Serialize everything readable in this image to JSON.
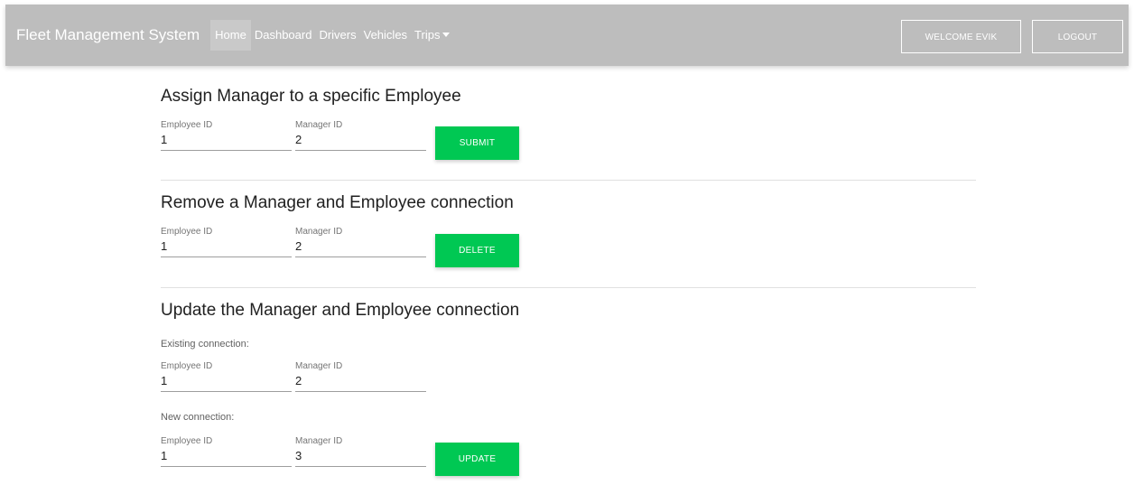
{
  "navbar": {
    "brand": "Fleet Management System",
    "links": [
      {
        "label": "Home",
        "active": true
      },
      {
        "label": "Dashboard",
        "active": false
      },
      {
        "label": "Drivers",
        "active": false
      },
      {
        "label": "Vehicles",
        "active": false
      },
      {
        "label": "Trips",
        "active": false,
        "dropdown": true
      }
    ],
    "welcome_label": "WELCOME EVIK",
    "logout_label": "LOGOUT"
  },
  "colors": {
    "navbar_bg": "#bdbdbd",
    "accent_green": "#00c853"
  },
  "assign": {
    "title": "Assign Manager to a specific Employee",
    "employee_label": "Employee ID",
    "employee_value": "1",
    "manager_label": "Manager ID",
    "manager_value": "2",
    "button_label": "SUBMIT"
  },
  "remove": {
    "title": "Remove a Manager and Employee connection",
    "employee_label": "Employee ID",
    "employee_value": "1",
    "manager_label": "Manager ID",
    "manager_value": "2",
    "button_label": "DELETE"
  },
  "update": {
    "title": "Update the Manager and Employee connection",
    "existing_label": "Existing connection:",
    "existing_employee_label": "Employee ID",
    "existing_employee_value": "1",
    "existing_manager_label": "Manager ID",
    "existing_manager_value": "2",
    "new_label": "New connection:",
    "new_employee_label": "Employee ID",
    "new_employee_value": "1",
    "new_manager_label": "Manager ID",
    "new_manager_value": "3",
    "button_label": "UPDATE"
  }
}
